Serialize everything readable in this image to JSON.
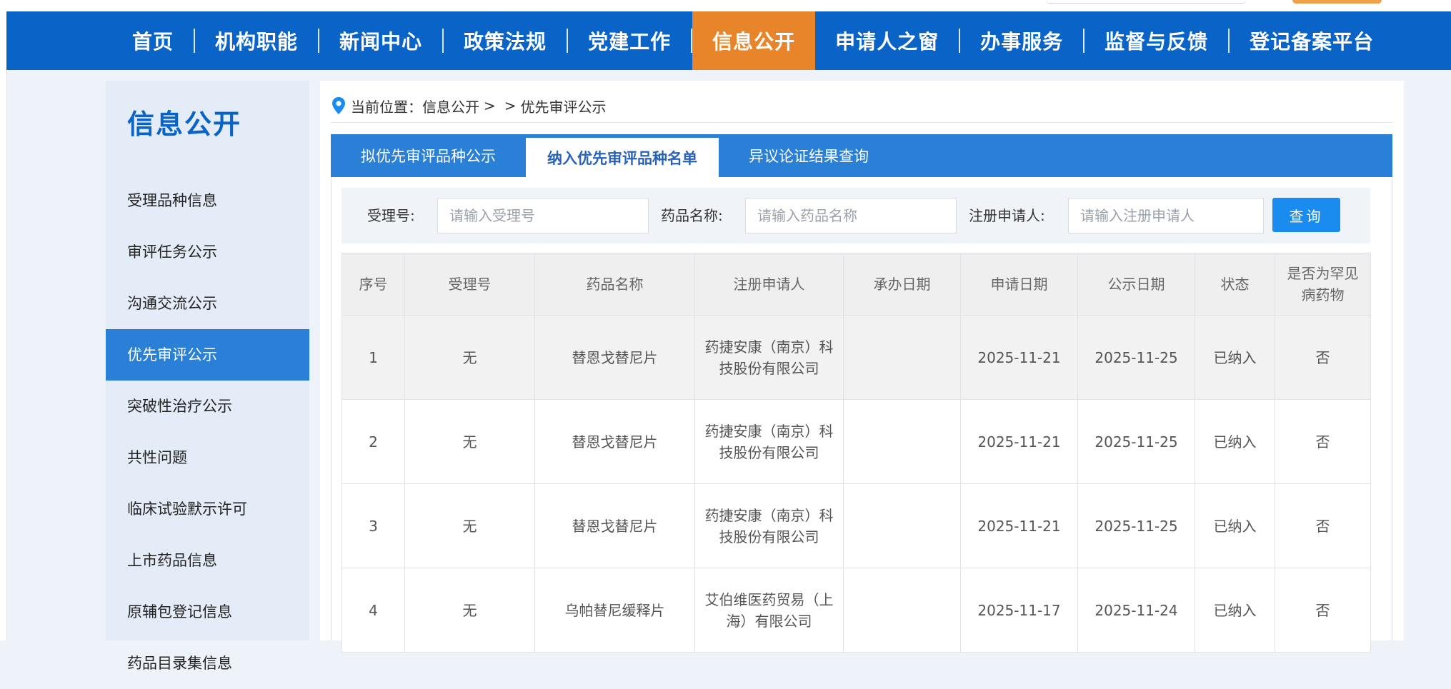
{
  "nav": {
    "items": [
      {
        "label": "首页",
        "active": false
      },
      {
        "label": "机构职能",
        "active": false
      },
      {
        "label": "新闻中心",
        "active": false
      },
      {
        "label": "政策法规",
        "active": false
      },
      {
        "label": "党建工作",
        "active": false
      },
      {
        "label": "信息公开",
        "active": true
      },
      {
        "label": "申请人之窗",
        "active": false
      },
      {
        "label": "办事服务",
        "active": false
      },
      {
        "label": "监督与反馈",
        "active": false
      },
      {
        "label": "登记备案平台",
        "active": false
      }
    ]
  },
  "sidebar": {
    "title": "信息公开",
    "items": [
      {
        "label": "受理品种信息",
        "active": false
      },
      {
        "label": "审评任务公示",
        "active": false
      },
      {
        "label": "沟通交流公示",
        "active": false
      },
      {
        "label": "优先审评公示",
        "active": true
      },
      {
        "label": "突破性治疗公示",
        "active": false
      },
      {
        "label": "共性问题",
        "active": false
      },
      {
        "label": "临床试验默示许可",
        "active": false
      },
      {
        "label": "上市药品信息",
        "active": false
      },
      {
        "label": "原辅包登记信息",
        "active": false
      },
      {
        "label": "药品目录集信息",
        "active": false
      }
    ]
  },
  "breadcrumb": {
    "prefix": "当前位置：",
    "level1": "信息公开",
    "sep": ">",
    "sep2": ">",
    "level2": "优先审评公示"
  },
  "tabs": [
    {
      "label": "拟优先审评品种公示",
      "active": false
    },
    {
      "label": "纳入优先审评品种名单",
      "active": true
    },
    {
      "label": "异议论证结果查询",
      "active": false
    }
  ],
  "search": {
    "accept_no_label": "受理号:",
    "accept_no_placeholder": "请输入受理号",
    "drug_name_label": "药品名称:",
    "drug_name_placeholder": "请输入药品名称",
    "applicant_label": "注册申请人:",
    "applicant_placeholder": "请输入注册申请人",
    "query_button": "查询"
  },
  "table": {
    "headers": [
      "序号",
      "受理号",
      "药品名称",
      "注册申请人",
      "承办日期",
      "申请日期",
      "公示日期",
      "状态",
      "是否为罕见病药物"
    ],
    "rows": [
      {
        "no": "1",
        "accept_no": "无",
        "drug": "替恩戈替尼片",
        "applicant": "药捷安康（南京）科技股份有限公司",
        "handle_date": "",
        "apply_date": "2025-11-21",
        "publish_date": "2025-11-25",
        "status": "已纳入",
        "rare": "否"
      },
      {
        "no": "2",
        "accept_no": "无",
        "drug": "替恩戈替尼片",
        "applicant": "药捷安康（南京）科技股份有限公司",
        "handle_date": "",
        "apply_date": "2025-11-21",
        "publish_date": "2025-11-25",
        "status": "已纳入",
        "rare": "否"
      },
      {
        "no": "3",
        "accept_no": "无",
        "drug": "替恩戈替尼片",
        "applicant": "药捷安康（南京）科技股份有限公司",
        "handle_date": "",
        "apply_date": "2025-11-21",
        "publish_date": "2025-11-25",
        "status": "已纳入",
        "rare": "否"
      },
      {
        "no": "4",
        "accept_no": "无",
        "drug": "乌帕替尼缓释片",
        "applicant": "艾伯维医药贸易（上海）有限公司",
        "handle_date": "",
        "apply_date": "2025-11-17",
        "publish_date": "2025-11-24",
        "status": "已纳入",
        "rare": "否"
      }
    ]
  },
  "colors": {
    "nav_bg": "#0a64c8",
    "nav_active": "#e8852a",
    "sidebar_active": "#2a7fd6",
    "tab_bar": "#2a7fd6",
    "query_button": "#1a8cf0"
  },
  "icons": {
    "breadcrumb": "location-pin-icon"
  }
}
